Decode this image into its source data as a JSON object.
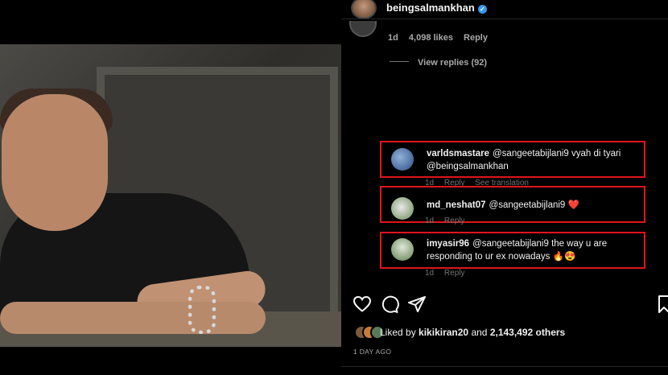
{
  "post": {
    "username": "beingsalmankhan",
    "verified_mark": "✓"
  },
  "prev_comment": {
    "age": "1d",
    "likes": "4,098 likes",
    "reply": "Reply",
    "view_replies": "View replies (92)"
  },
  "comments": [
    {
      "user": "varldsmastare",
      "text": "@sangeetabijlani9 vyah di tyari @beingsalmankhan",
      "age": "1d",
      "reply": "Reply",
      "translation": "See translation"
    },
    {
      "user": "md_neshat07",
      "text": "@sangeetabijlani9",
      "emoji": "❤️",
      "age": "1d",
      "reply": "Reply"
    },
    {
      "user": "imyasir96",
      "text": "@sangeetabijlani9 the way u are responding to ur ex nowadays",
      "emoji": "🔥😍",
      "age": "1d",
      "reply": "Reply"
    }
  ],
  "likes": {
    "prefix": "Liked by",
    "user": "kikikiran20",
    "connector": "and",
    "others": "2,143,492 others"
  },
  "time_ago": "1 DAY AGO",
  "icons": {
    "like": "heart-icon",
    "comment": "comment-icon",
    "share": "send-icon",
    "save": "bookmark-icon"
  },
  "colors": {
    "highlight": "#e0141e",
    "verified": "#3897f0",
    "heart_emoji": "#ed2b3c"
  }
}
